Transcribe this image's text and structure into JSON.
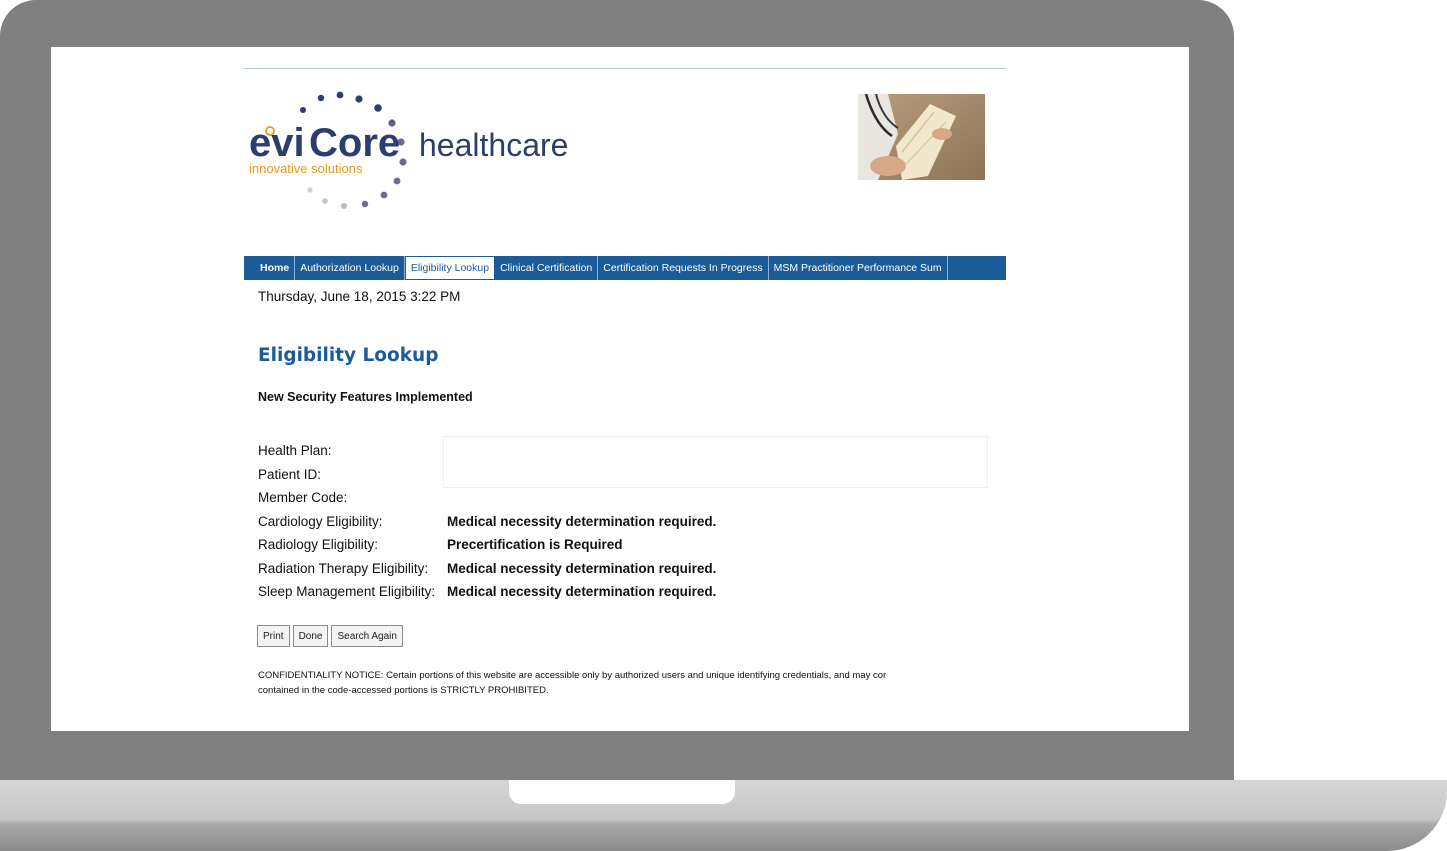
{
  "brand": {
    "name_part1": "evi",
    "name_part2": "Core",
    "suffix": "healthcare",
    "tagline": "innovative solutions"
  },
  "nav": {
    "items": [
      {
        "label": "Home",
        "active": false
      },
      {
        "label": "Authorization Lookup",
        "active": false
      },
      {
        "label": "Eligibility Lookup",
        "active": true
      },
      {
        "label": "Clinical Certification",
        "active": false
      },
      {
        "label": "Certification Requests In Progress",
        "active": false
      },
      {
        "label": "MSM Practitioner Performance Sum",
        "active": false
      }
    ]
  },
  "date_time": "Thursday, June 18, 2015 3:22 PM",
  "page_title": "Eligibility Lookup",
  "notice_heading": "New Security Features Implemented",
  "details": [
    {
      "label": "Health Plan:",
      "value": ""
    },
    {
      "label": "Patient ID:",
      "value": ""
    },
    {
      "label": "Member Code:",
      "value": ""
    },
    {
      "label": "Cardiology Eligibility:",
      "value": "Medical necessity determination required."
    },
    {
      "label": "Radiology Eligibility:",
      "value": "Precertification is Required"
    },
    {
      "label": "Radiation Therapy Eligibility:",
      "value": "Medical necessity determination required."
    },
    {
      "label": "Sleep Management Eligibility:",
      "value": "Medical necessity determination required."
    }
  ],
  "buttons": {
    "print": "Print",
    "done": "Done",
    "search_again": "Search Again"
  },
  "confidentiality": {
    "line1": "CONFIDENTIALITY NOTICE: Certain portions of this website are accessible only by authorized users and unique identifying credentials, and may cor",
    "line2": "contained in the code-accessed portions is STRICTLY PROHIBITED."
  },
  "colors": {
    "brand_blue": "#1b5b98",
    "logo_navy": "#2c3e6b",
    "logo_orange": "#e39a1c",
    "frame_gray": "#808080"
  }
}
